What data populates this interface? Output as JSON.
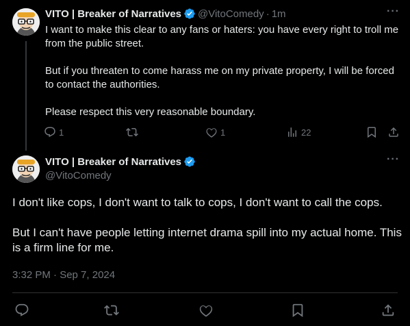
{
  "reply_tweet": {
    "author_name": "VITO | Breaker of Narratives",
    "handle": "@VitoComedy",
    "separator": "·",
    "time": "1m",
    "paragraphs": [
      "I want to make this clear to any fans or haters: you have every right to troll me from the public street.",
      "But if you threaten to come harass me on my private property, I will be forced to contact the authorities.",
      "Please respect this very reasonable boundary."
    ],
    "stats": {
      "replies": "1",
      "reposts": "",
      "likes": "1",
      "views": "22"
    }
  },
  "main_tweet": {
    "author_name": "VITO | Breaker of Narratives",
    "handle": "@VitoComedy",
    "paragraphs": [
      "I don't like cops, I don't want to talk to cops, I don't want to call the cops.",
      "But I can't have people letting internet drama spill into my actual home. This is a firm line for me."
    ],
    "timestamp": "3:32 PM · Sep 7, 2024"
  },
  "icons": {
    "more": "more-icon",
    "verified": "verified-badge-icon",
    "reply": "reply-icon",
    "repost": "repost-icon",
    "like": "like-icon",
    "views": "views-icon",
    "bookmark": "bookmark-icon",
    "share": "share-icon"
  },
  "colors": {
    "background": "#000000",
    "text": "#e7e9ea",
    "muted": "#71767b",
    "verified": "#1d9bf0",
    "divider": "#2f3336"
  }
}
